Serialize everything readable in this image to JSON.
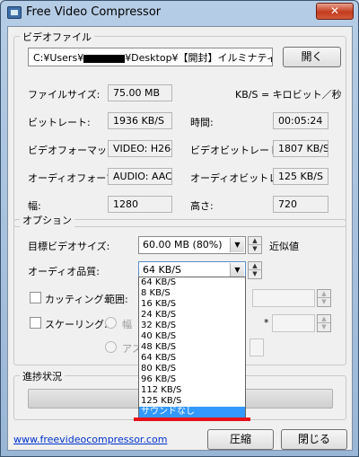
{
  "window": {
    "title": "Free Video Compressor",
    "close_glyph": "✕"
  },
  "video_file": {
    "group_label": "ビデオファイル",
    "path_prefix": "C:¥Users¥",
    "path_suffix": "¥Desktop¥【開封】イルミナティカード",
    "open_button": "開く",
    "file_size_label": "ファイルサイズ:",
    "file_size": "75.00 MB",
    "unit_note": "KB/S = キロビット／秒",
    "bitrate_label": "ビットレート:",
    "bitrate": "1936 KB/S",
    "time_label": "時間:",
    "time": "00:05:24",
    "video_format_label": "ビデオフォーマット:",
    "video_format": "VIDEO: H264",
    "video_bitrate_label": "ビデオビットレート:",
    "video_bitrate": "1807 KB/S",
    "audio_format_label": "オーディオフォーマット:",
    "audio_format": "AUDIO: AAC",
    "audio_bitrate_label": "オーディオビットレート:",
    "audio_bitrate": "125 KB/S",
    "width_label": "幅:",
    "width": "1280",
    "height_label": "高さ:",
    "height": "720"
  },
  "options": {
    "group_label": "オプション",
    "target_size_label": "目標ビデオサイズ:",
    "target_size": "60.00 MB (80%)",
    "approx_label": "近似値",
    "audio_quality_label": "オーディオ品質:",
    "audio_quality": "64 KB/S",
    "cutting_label": "カッティング:",
    "range_label": "範囲:",
    "scaling_label": "スケーリング:",
    "width_radio_label": "幅",
    "aspect_radio_label": "アス",
    "times_sign": "*",
    "audio_options": [
      "64 KB/S",
      "8 KB/S",
      "16 KB/S",
      "24 KB/S",
      "32 KB/S",
      "40 KB/S",
      "48 KB/S",
      "64 KB/S",
      "80 KB/S",
      "96 KB/S",
      "112 KB/S",
      "125 KB/S",
      "サウンドなし"
    ],
    "audio_selected_index": 12
  },
  "progress": {
    "group_label": "進捗状況",
    "value_percent": 0
  },
  "footer": {
    "link": "www.freevideocompressor.com",
    "compress_button": "圧縮",
    "close_button": "閉じる"
  },
  "colors": {
    "highlight": "#3399ff",
    "annotation_underline": "#e8101a",
    "link": "#0033cc"
  }
}
